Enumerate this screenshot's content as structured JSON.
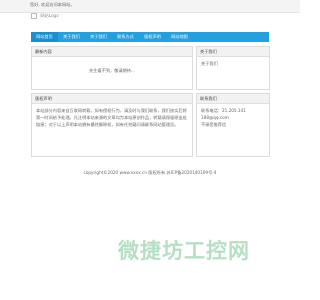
{
  "topbar": {
    "text": "您好, 欢迎访问本网站。"
  },
  "logo": {
    "alt": "网站Logo"
  },
  "nav": {
    "items": [
      "网站首页",
      "关于我们",
      "关于我们",
      "联系方式",
      "版权声明",
      "网站地图"
    ]
  },
  "panels": {
    "news": {
      "title": "最新内容",
      "body": "先生看不到，敬请期待..."
    },
    "about": {
      "title": "关于我们",
      "body": "关于我们"
    },
    "copyright": {
      "title": "版权声明",
      "body": "本站部分内容来自互联网转载，如有侵权行为，请及时与我们联系，我们核实后将第一时间给予处理。凡注明本站来源的文章均为本站原创作品，转载请保留原出处链接；对于以上声明本站拥有最终解释权，如有任何疑问请联系网站管理员。"
    },
    "contact": {
      "title": "联系我们",
      "lines": [
        "联系电话：21.205.141  188@qq.com",
        "不接受推荐信"
      ]
    }
  },
  "footer": {
    "text": "copyright©2020 www.xxxx.cn 版权所有  苏ICP备2020140109号-4"
  },
  "watermark": {
    "text": "微捷坊工控网"
  }
}
